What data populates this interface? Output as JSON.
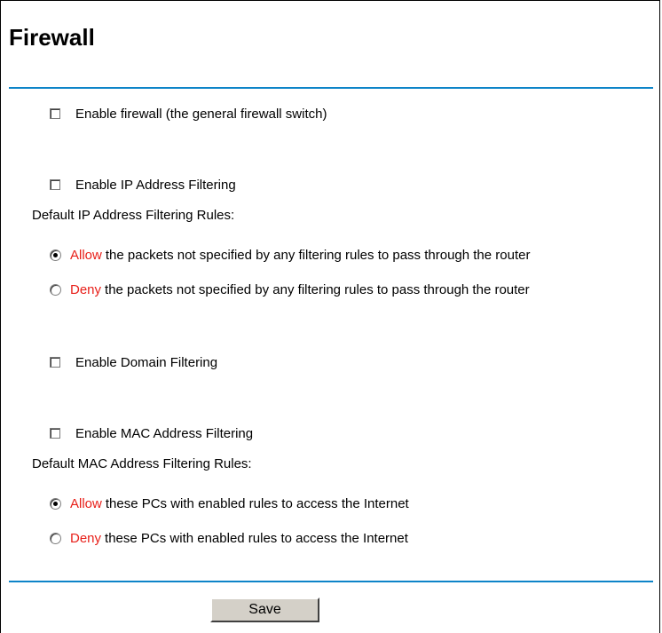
{
  "page": {
    "title": "Firewall"
  },
  "firewall": {
    "enable_label": "Enable firewall (the general firewall switch)",
    "enabled": false
  },
  "ip_filtering": {
    "enable_label": "Enable IP Address Filtering",
    "enabled": false,
    "rules_heading": "Default IP Address Filtering Rules:",
    "options": [
      {
        "keyword": "Allow",
        "text": "the packets not specified by any filtering rules to pass through the router",
        "selected": true
      },
      {
        "keyword": "Deny",
        "text": "the packets not specified by any filtering rules to pass through the router",
        "selected": false
      }
    ]
  },
  "domain_filtering": {
    "enable_label": "Enable Domain Filtering",
    "enabled": false
  },
  "mac_filtering": {
    "enable_label": "Enable MAC Address Filtering",
    "enabled": false,
    "rules_heading": "Default MAC Address Filtering Rules:",
    "options": [
      {
        "keyword": "Allow",
        "text": "these PCs with enabled rules to access the Internet",
        "selected": true
      },
      {
        "keyword": "Deny",
        "text": "these PCs with enabled rules to access the Internet",
        "selected": false
      }
    ]
  },
  "actions": {
    "save_label": "Save"
  },
  "colors": {
    "accent_rule": "#0d84c8",
    "keyword_red": "#e8201a"
  }
}
